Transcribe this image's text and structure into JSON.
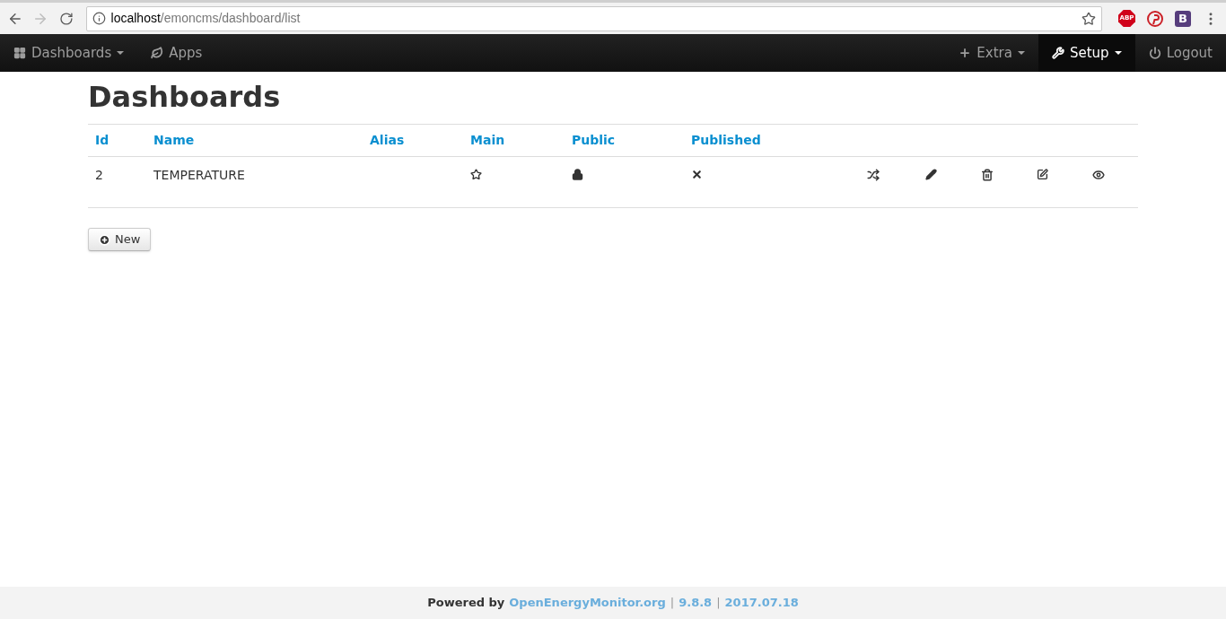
{
  "browser": {
    "url_host": "localhost",
    "url_path": "/emoncms/dashboard/list",
    "extensions": [
      {
        "kind": "abp",
        "label": "ABP"
      },
      {
        "kind": "pin"
      },
      {
        "kind": "b",
        "label": "B"
      }
    ]
  },
  "navbar": {
    "left": [
      {
        "label": "Dashboards",
        "kind": "grid",
        "dropdown": true,
        "selected": false
      },
      {
        "label": "Apps",
        "kind": "leaf",
        "dropdown": false,
        "selected": false
      }
    ],
    "right": [
      {
        "label": "Extra",
        "kind": "plus",
        "dropdown": true,
        "selected": false
      },
      {
        "label": "Setup",
        "kind": "wrench",
        "dropdown": true,
        "selected": true
      },
      {
        "label": "Logout",
        "kind": "power",
        "dropdown": false,
        "selected": false
      }
    ]
  },
  "page": {
    "title": "Dashboards"
  },
  "table": {
    "columns": [
      "Id",
      "Name",
      "Alias",
      "Main",
      "Public",
      "Published"
    ],
    "rows": [
      {
        "id": "2",
        "name": "TEMPERATURE",
        "main": false,
        "public": false,
        "published": false
      }
    ]
  },
  "new_button": {
    "label": "New"
  },
  "footer": [
    {
      "kind": "label",
      "text": "Powered by"
    },
    {
      "kind": "link",
      "text": "OpenEnergyMonitor.org"
    },
    {
      "kind": "separator",
      "text": "|"
    },
    {
      "kind": "link",
      "text": "9.8.8"
    },
    {
      "kind": "separator",
      "text": "|"
    },
    {
      "kind": "link",
      "text": "2017.07.18"
    }
  ]
}
